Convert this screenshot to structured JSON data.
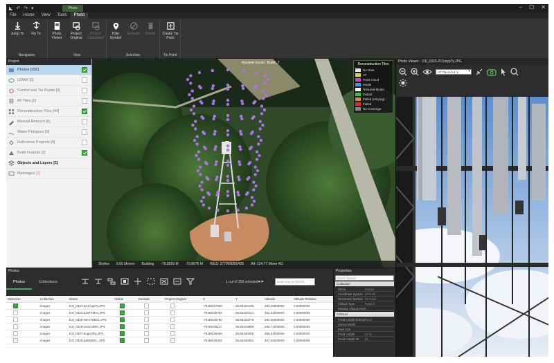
{
  "menu": [
    "File",
    "Home",
    "View",
    "Tools",
    "Photo"
  ],
  "context_tab": "Photo",
  "ribbon": {
    "groups": [
      {
        "label": "Navigation",
        "buttons": [
          {
            "label": "Jump To"
          },
          {
            "label": "Fly To"
          }
        ]
      },
      {
        "label": "View",
        "buttons": [
          {
            "label": "Photo Viewer"
          },
          {
            "label": "Project Original"
          },
          {
            "label": "Project Calculated"
          }
        ]
      },
      {
        "label": "Selection",
        "buttons": [
          {
            "label": "Hide Symbol"
          },
          {
            "label": "Exclude"
          },
          {
            "label": "Delete"
          }
        ]
      },
      {
        "label": "Tie Point",
        "buttons": [
          {
            "label": "Create Tie Point"
          }
        ]
      }
    ]
  },
  "project": {
    "header": "Project",
    "items": [
      {
        "label": "Photos",
        "count": "[356]",
        "checked": true,
        "icon": "photo-icon"
      },
      {
        "label": "LiDAR",
        "count": "[0]",
        "checked": false,
        "icon": "lidar-icon"
      },
      {
        "label": "Control and Tie Points",
        "count": "[0]",
        "checked": false,
        "icon": "control-points-icon"
      },
      {
        "label": "AT Tiles",
        "count": "[1]",
        "checked": false,
        "icon": "at-tiles-icon"
      },
      {
        "label": "Reconstruction Tiles",
        "count": "[44]",
        "checked": true,
        "icon": "reconstruction-tiles-icon"
      },
      {
        "label": "Manual Retouch",
        "count": "[0]",
        "checked": false,
        "icon": "retouch-icon"
      },
      {
        "label": "Water Polygons",
        "count": "[0]",
        "checked": false,
        "icon": "water-polygon-icon"
      },
      {
        "label": "Reference Projects",
        "count": "[0]",
        "checked": false,
        "icon": "reference-icon"
      },
      {
        "label": "Build Outputs",
        "count": "[2]",
        "checked": true,
        "icon": "build-outputs-icon"
      },
      {
        "label": "Objects and Layers",
        "count": "[1]",
        "checked": null,
        "icon": "layers-icon"
      },
      {
        "label": "Messages",
        "count": "(2)",
        "checked": null,
        "icon": "messages-icon"
      }
    ]
  },
  "viewport": {
    "review_mode": "Review mode: Build_7",
    "legend_title": "Reconstruction Tiles",
    "legend": [
      {
        "label": "No Data",
        "color": "#e8e8e8"
      },
      {
        "label": "AT",
        "color": "#d8d84a"
      },
      {
        "label": "Point Cloud",
        "color": "#d040d0"
      },
      {
        "label": "Model",
        "color": "#4a90e0"
      },
      {
        "label": "Textured Model",
        "color": "#ffffff"
      },
      {
        "label": "Output",
        "color": "#40c040"
      },
      {
        "label": "Failed (retrying)",
        "color": "#e08a30"
      },
      {
        "label": "Failed",
        "color": "#d03030"
      },
      {
        "label": "No Coverage",
        "color": "#888888"
      }
    ],
    "status": [
      "Skyline",
      "8.66 Meters",
      "Building",
      "-79.8659 M",
      "-79.8676 M",
      "WGS: 27795N35542E",
      "Alt: 124.77 Meter AG"
    ]
  },
  "photo_viewer": {
    "title": "Photo Viewer - DJI_0323-2C1mypTy.JPG",
    "select_value": "AT Tile-0-0-1-1"
  },
  "photos_panel": {
    "header": "Photos",
    "tabs": [
      "Photos",
      "Collections"
    ],
    "status": "1 out of 356 selected",
    "search_placeholder": "Enter text to search...",
    "columns": [
      "Selection",
      "Collection",
      "Name",
      "Visible",
      "Exclude",
      "Project Original",
      "X",
      "Y",
      "Altitude",
      "Altitude Relative"
    ],
    "rows": [
      {
        "sel": true,
        "collection": "images",
        "name": "DJI_0323-2C1mypTy.JPG",
        "visible": true,
        "x": "-79.88427900",
        "y": "36.66320196",
        "alt": "284.23000000",
        "rel": "0.00000000"
      },
      {
        "sel": false,
        "collection": "images",
        "name": "DJI_0324-azeFTMAs.JPG",
        "visible": true,
        "x": "-79.88425784",
        "y": "36.66320114",
        "alt": "284.31000000",
        "rel": "0.00000000"
      },
      {
        "sel": false,
        "collection": "images",
        "name": "DJI_0325-WmrT8BX1.JPG",
        "visible": true,
        "x": "-79.88425780",
        "y": "36.66320278",
        "alt": "284.36000000",
        "rel": "0.00000000"
      },
      {
        "sel": false,
        "collection": "images",
        "name": "DJI_0326-UxaCSBIH.JPG",
        "visible": true,
        "x": "-79.88426117",
        "y": "36.66319988",
        "alt": "286.71000000",
        "rel": "0.00000000"
      },
      {
        "sel": false,
        "collection": "images",
        "name": "DJI_0327-dogKZfNj.JPG",
        "visible": true,
        "x": "-79.88426069",
        "y": "36.66320008",
        "alt": "286.31000000",
        "rel": "0.00000000"
      },
      {
        "sel": false,
        "collection": "images",
        "name": "DJI_0328-aZBdS03...JPG",
        "visible": true,
        "x": "-79.88426002",
        "y": "36.66320001",
        "alt": "287.53000000",
        "rel": "0.00000000"
      }
    ]
  },
  "properties": {
    "header": "Properties",
    "search_placeholder": "Quick Search",
    "sections": [
      {
        "title": "Collection",
        "rows": [
          [
            "Name",
            "images"
          ],
          [
            "Coordinate System",
            "WGS 84"
          ],
          [
            "Orientation Method",
            "Tie-Point"
          ],
          [
            "Altitude Type",
            "Relative"
          ],
          [
            "Relative Altitude Reference",
            "0"
          ]
        ]
      },
      {
        "title": "Camera",
        "rows": [
          [
            "Focal Length Normalization",
            "Focal"
          ],
          [
            "Sensor Width",
            ""
          ],
          [
            "Pixel Size",
            ""
          ],
          [
            "Focal Length",
            "10.26"
          ],
          [
            "Focal Length 35",
            "29"
          ]
        ]
      }
    ]
  }
}
